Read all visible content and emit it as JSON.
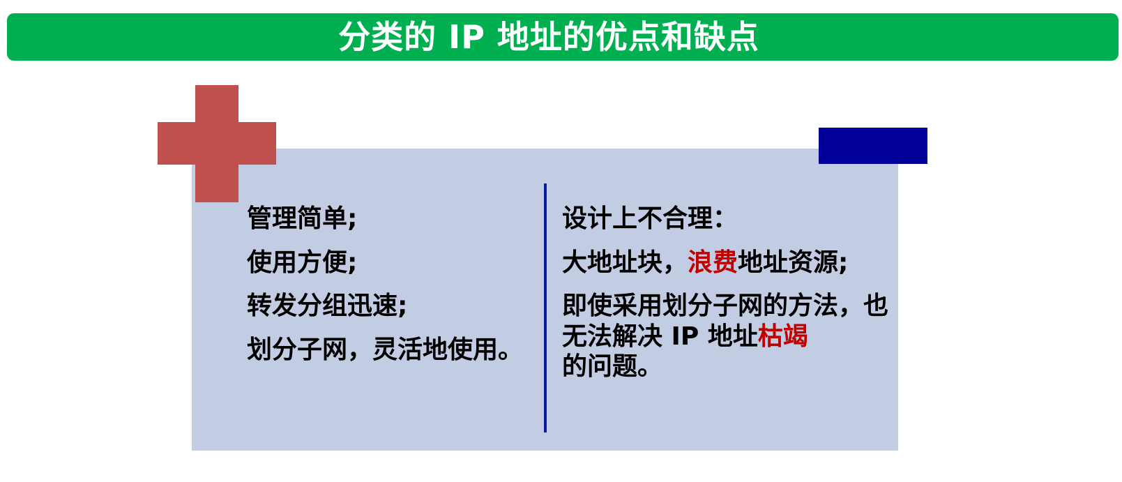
{
  "title": "分类的 IP 地址的优点和缺点",
  "advantages": {
    "icon": "plus-icon",
    "icon_color": "#c0504d",
    "items": [
      "管理简单;",
      "使用方便;",
      "转发分组迅速;",
      "划分子网，灵活地使用。"
    ]
  },
  "disadvantages": {
    "icon": "minus-icon",
    "icon_color": "#000099",
    "heading": "设计上不合理：",
    "item1": {
      "prefix": "大地址块，",
      "highlight": "浪费",
      "suffix": "地址资源;"
    },
    "item2": {
      "prefix": "即使采用划分子网的方法，也无法解决 IP 地址",
      "highlight": "枯竭",
      "suffix": "的问题。"
    }
  },
  "colors": {
    "title_bar": "#00b050",
    "panel": "#c2cce2",
    "divider": "#0b1aa6",
    "highlight": "#c00000"
  }
}
